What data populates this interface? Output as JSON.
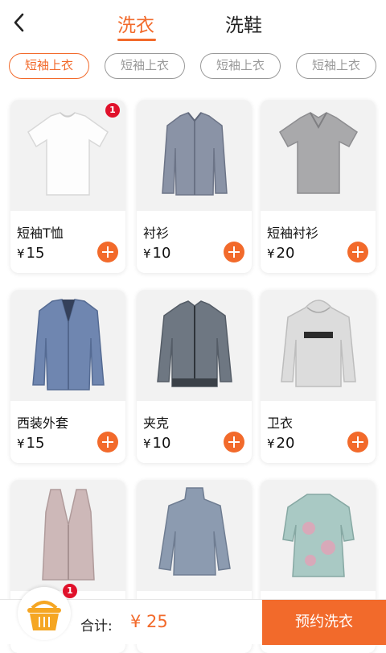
{
  "header": {
    "tabs": [
      {
        "label": "洗衣",
        "active": true
      },
      {
        "label": "洗鞋",
        "active": false
      }
    ]
  },
  "filters": [
    {
      "label": "短袖上衣",
      "active": true
    },
    {
      "label": "短袖上衣",
      "active": false
    },
    {
      "label": "短袖上衣",
      "active": false
    },
    {
      "label": "短袖上衣",
      "active": false
    }
  ],
  "products": [
    {
      "name": "短袖T恤",
      "currency": "¥",
      "price": "15",
      "badge": "1",
      "image": "white-tshirt"
    },
    {
      "name": "衬衫",
      "currency": "¥",
      "price": "10",
      "image": "gray-dress-shirt"
    },
    {
      "name": "短袖衬衫",
      "currency": "¥",
      "price": "20",
      "image": "gray-polo-shirt"
    },
    {
      "name": "西装外套",
      "currency": "¥",
      "price": "15",
      "image": "blue-suit-jacket"
    },
    {
      "name": "夹克",
      "currency": "¥",
      "price": "10",
      "image": "gray-bomber-jacket"
    },
    {
      "name": "卫衣",
      "currency": "¥",
      "price": "20",
      "image": "gray-hoodie"
    },
    {
      "name": "",
      "currency": "",
      "price": "",
      "image": "pink-knit-vest"
    },
    {
      "name": "",
      "currency": "",
      "price": "",
      "image": "blue-turtleneck-sweater"
    },
    {
      "name": "",
      "currency": "",
      "price": "",
      "image": "floral-qipao-jacket"
    }
  ],
  "footer": {
    "cart_badge": "1",
    "total_label": "合计:",
    "total_value": "¥ 25",
    "book_label": "预约洗衣"
  },
  "colors": {
    "accent": "#f26a2b",
    "badge": "#e0112b",
    "card_image_bg": "#f2f2f2"
  }
}
